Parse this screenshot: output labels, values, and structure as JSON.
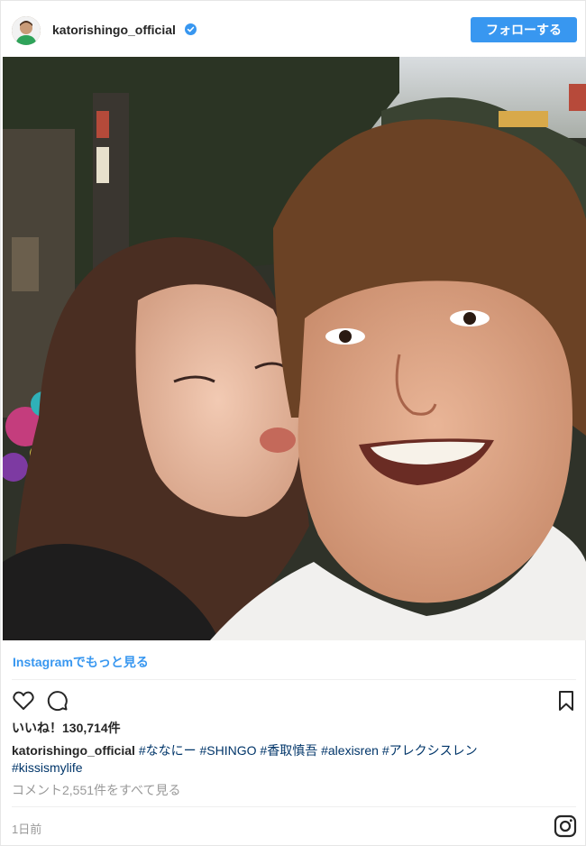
{
  "header": {
    "username": "katorishingo_official",
    "verified_icon": "verified-badge-icon",
    "follow_label": "フォローする",
    "avatar_icon": "profile-avatar"
  },
  "post": {
    "photo_alt": "selfie-photo",
    "more_link": "Instagramでもっと見る",
    "likes": "いいね！130,714件",
    "caption_user": "katorishingo_official",
    "hashtags": [
      "#ななにー",
      "#SHINGO",
      "#香取慎吾",
      "#alexisren",
      "#アレクシスレン",
      "#kissismylife"
    ],
    "view_comments": "コメント2,551件をすべて見る",
    "timestamp": "1日前"
  },
  "icons": {
    "like": "heart-icon",
    "comment": "comment-icon",
    "bookmark": "bookmark-icon",
    "instagram": "instagram-icon"
  },
  "colors": {
    "accent": "#3897f0",
    "hashtag": "#003569",
    "muted": "#999999",
    "text": "#262626"
  }
}
